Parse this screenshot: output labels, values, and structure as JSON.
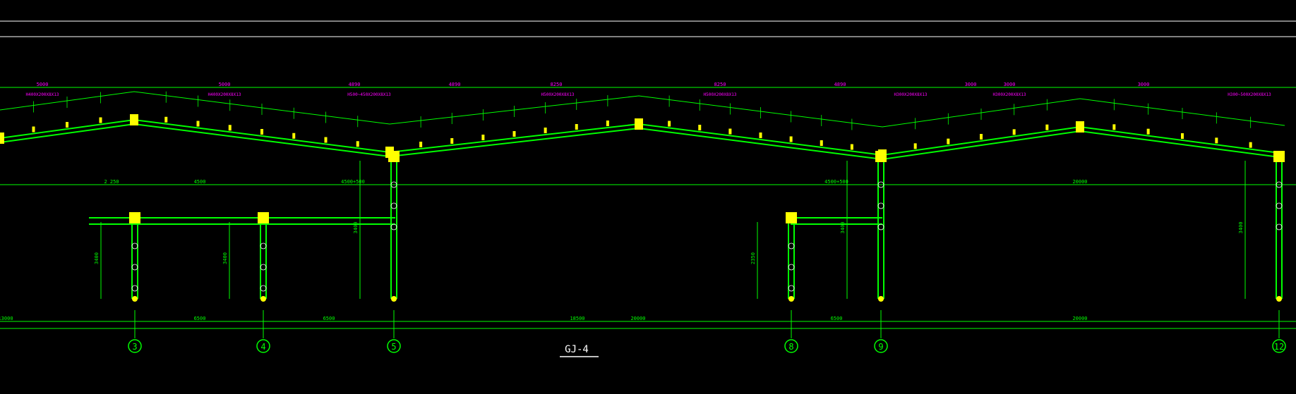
{
  "drawing": {
    "title": "GJ-4",
    "colors": {
      "background": "#000000",
      "frame": "#00ff00",
      "frame_bright": "#66ff33",
      "node": "#ffff00",
      "dim_text": "#ff00ff",
      "white": "#ffffff"
    },
    "grid_axes": [
      {
        "label": "3"
      },
      {
        "label": "4"
      },
      {
        "label": "5"
      },
      {
        "label": "8"
      },
      {
        "label": "9"
      },
      {
        "label": "12"
      }
    ],
    "top_dimensions": [
      "5000",
      "5000",
      "4890",
      "4890",
      "8250",
      "8250",
      "4890",
      "3000",
      "3000",
      "3000"
    ],
    "bottom_dimensions": [
      "13000",
      "6500",
      "6500",
      "18500",
      "20000",
      "6500",
      "20000"
    ],
    "mid_dimensions": [
      "2 250",
      "4500",
      "4500+500",
      "4500+500",
      "20000"
    ],
    "column_heights": [
      "3400",
      "3400",
      "3400",
      "2350",
      "3400",
      "3400",
      "3600"
    ],
    "section_notes": [
      "H400X200X8X13",
      "H400X200X8X13",
      "H500~450X200X8X13",
      "H500X200X8X13",
      "H500X200X8X13",
      "H300X200X8X13",
      "H300X200X8X13",
      "H300~500X200X8X13"
    ]
  }
}
